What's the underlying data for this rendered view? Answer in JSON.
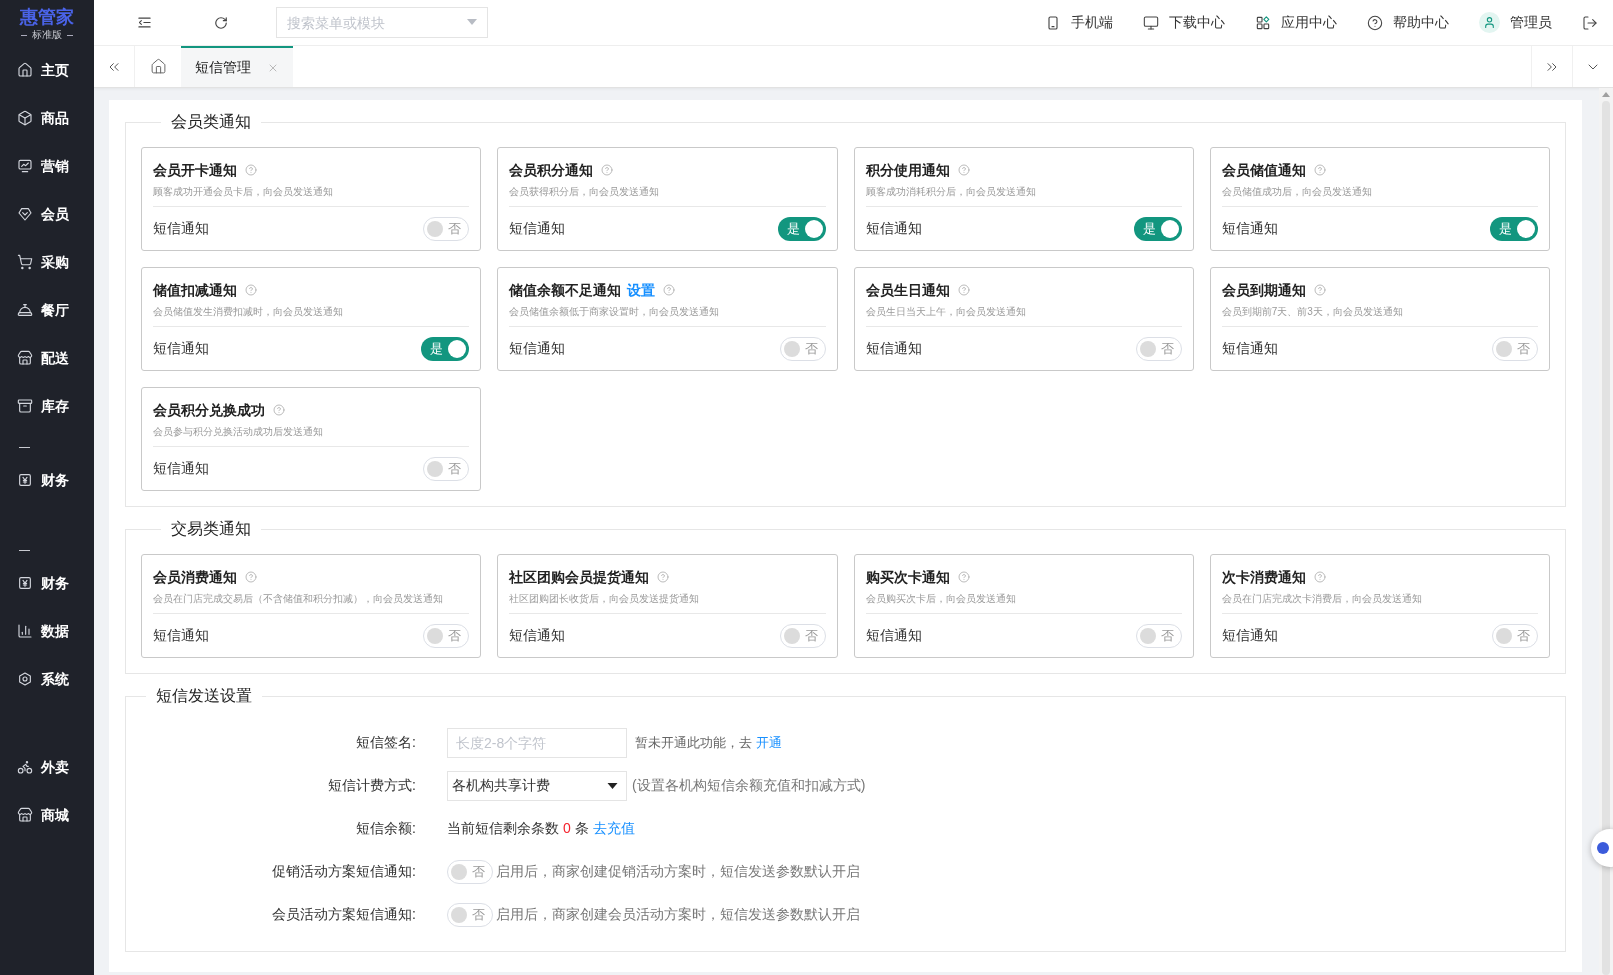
{
  "sidebar": {
    "logo": {
      "name": "惠管家",
      "edition": "标准版"
    },
    "sections": [
      {
        "separator": false,
        "items": [
          {
            "label": "主页"
          },
          {
            "label": "商品"
          },
          {
            "label": "营销"
          },
          {
            "label": "会员"
          },
          {
            "label": "采购"
          },
          {
            "label": "餐厅"
          },
          {
            "label": "配送"
          },
          {
            "label": "库存"
          }
        ]
      },
      {
        "separator": true,
        "items": [
          {
            "label": "财务"
          }
        ]
      },
      {
        "separator": true,
        "items": [
          {
            "label": "财务"
          },
          {
            "label": "数据"
          },
          {
            "label": "系统"
          }
        ]
      },
      {
        "separator": false,
        "items": [
          {
            "label": "外卖"
          },
          {
            "label": "商城"
          }
        ]
      }
    ]
  },
  "header": {
    "search": {
      "placeholder": "搜索菜单或模块"
    },
    "links": [
      {
        "label": "手机端"
      },
      {
        "label": "下载中心"
      },
      {
        "label": "应用中心"
      },
      {
        "label": "帮助中心"
      }
    ],
    "user": {
      "name": "管理员"
    }
  },
  "tabs": [
    {
      "label": "短信管理",
      "selected": true
    }
  ],
  "sections": [
    {
      "title": "会员类通知",
      "cards": [
        {
          "title": "会员开卡通知",
          "description": "顾客成功开通会员卡后，向会员发送通知",
          "setting": "短信通知",
          "switch": {
            "on": false,
            "text": "否"
          }
        },
        {
          "title": "会员积分通知",
          "description": "会员获得积分后，向会员发送通知",
          "setting": "短信通知",
          "switch": {
            "on": true,
            "text": "是"
          }
        },
        {
          "title": "积分使用通知",
          "description": "顾客成功消耗积分后，向会员发送通知",
          "setting": "短信通知",
          "switch": {
            "on": true,
            "text": "是"
          }
        },
        {
          "title": "会员储值通知",
          "description": "会员储值成功后，向会员发送通知",
          "setting": "短信通知",
          "switch": {
            "on": true,
            "text": "是"
          }
        },
        {
          "title": "储值扣减通知",
          "description": "会员储值发生消费扣减时，向会员发送通知",
          "setting": "短信通知",
          "switch": {
            "on": true,
            "text": "是"
          }
        },
        {
          "title": "储值余额不足通知",
          "link": "设置",
          "description": "会员储值余额低于商家设置时，向会员发送通知",
          "setting": "短信通知",
          "switch": {
            "on": false,
            "text": "否"
          }
        },
        {
          "title": "会员生日通知",
          "description": "会员生日当天上午，向会员发送通知",
          "setting": "短信通知",
          "switch": {
            "on": false,
            "text": "否"
          }
        },
        {
          "title": "会员到期通知",
          "description": "会员到期前7天、前3天，向会员发送通知",
          "setting": "短信通知",
          "switch": {
            "on": false,
            "text": "否"
          }
        },
        {
          "title": "会员积分兑换成功",
          "description": "会员参与积分兑换活动成功后发送通知",
          "setting": "短信通知",
          "switch": {
            "on": false,
            "text": "否"
          }
        }
      ]
    },
    {
      "title": "交易类通知",
      "cards": [
        {
          "title": "会员消费通知",
          "description": "会员在门店完成交易后（不含储值和积分扣减），向会员发送通知",
          "setting": "短信通知",
          "switch": {
            "on": false,
            "text": "否"
          }
        },
        {
          "title": "社区团购会员提货通知",
          "description": "社区团购团长收货后，向会员发送提货通知",
          "setting": "短信通知",
          "switch": {
            "on": false,
            "text": "否"
          }
        },
        {
          "title": "购买次卡通知",
          "description": "会员购买次卡后，向会员发送通知",
          "setting": "短信通知",
          "switch": {
            "on": false,
            "text": "否"
          }
        },
        {
          "title": "次卡消费通知",
          "description": "会员在门店完成次卡消费后，向会员发送通知",
          "setting": "短信通知",
          "switch": {
            "on": false,
            "text": "否"
          }
        }
      ]
    }
  ],
  "sms_settings": {
    "title": "短信发送设置",
    "rows": [
      {
        "kind": "input",
        "label": "短信签名:",
        "placeholder": "长度2-8个字符",
        "note": "暂未开通此功能，去",
        "link": "开通"
      },
      {
        "kind": "select",
        "label": "短信计费方式:",
        "value": "各机构共享计费",
        "note": "(设置各机构短信余额充值和扣减方式)"
      },
      {
        "kind": "balance",
        "label": "短信余额:",
        "text": "当前短信剩余条数",
        "count": "0",
        "unit": "条",
        "link": "去充值"
      },
      {
        "kind": "switch",
        "label": "促销活动方案短信通知:",
        "switch": {
          "on": false,
          "text": "否"
        },
        "note": "启用后，商家创建促销活动方案时，短信发送参数默认开启"
      },
      {
        "kind": "switch",
        "label": "会员活动方案短信通知:",
        "switch": {
          "on": false,
          "text": "否"
        },
        "note": "启用后，商家创建会员活动方案时，短信发送参数默认开启"
      }
    ]
  }
}
